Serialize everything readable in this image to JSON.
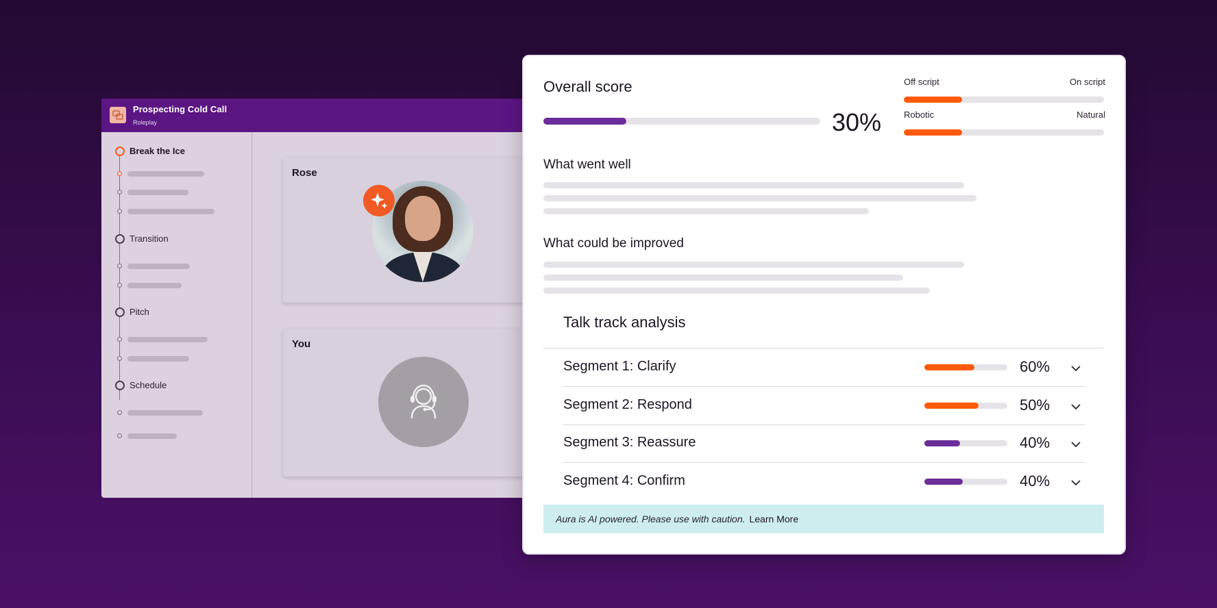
{
  "roleplay": {
    "title": "Prospecting Cold Call",
    "subtitle": "Roleplay",
    "steps": [
      {
        "label": "Break the Ice",
        "active": true
      },
      {
        "label": "Transition",
        "active": false
      },
      {
        "label": "Pitch",
        "active": false
      },
      {
        "label": "Schedule",
        "active": false
      }
    ],
    "participants": {
      "ai_name": "Rose",
      "user_name": "You"
    }
  },
  "score": {
    "title": "Overall score",
    "value_text": "30%",
    "value": 0.3,
    "scales": [
      {
        "left": "Off script",
        "right": "On script",
        "value": 0.29
      },
      {
        "left": "Robotic",
        "right": "Natural",
        "value": 0.29
      }
    ],
    "went_well_title": "What went well",
    "improve_title": "What could be improved"
  },
  "talk_track": {
    "title": "Talk track analysis",
    "segments": [
      {
        "label": "Segment 1: Clarify",
        "pct_text": "60%",
        "fill": 0.6,
        "color": "#ff5a0a"
      },
      {
        "label": "Segment 2: Respond",
        "pct_text": "50%",
        "fill": 0.65,
        "color": "#ff5a0a"
      },
      {
        "label": "Segment 3: Reassure",
        "pct_text": "40%",
        "fill": 0.43,
        "color": "#6b2d99"
      },
      {
        "label": "Segment 4: Confirm",
        "pct_text": "40%",
        "fill": 0.46,
        "color": "#6b2d99"
      }
    ]
  },
  "disclaimer": {
    "text": "Aura is AI powered. Please use with caution.",
    "link": "Learn More"
  },
  "colors": {
    "accent_purple": "#6b2d99",
    "accent_orange": "#ff5a0a",
    "header_purple": "#5b1683",
    "disclaimer_bg": "#cdeeed"
  },
  "icons": [
    "logo-icon",
    "sparkle-icon",
    "headset-user-icon",
    "chevron-down-icon"
  ]
}
